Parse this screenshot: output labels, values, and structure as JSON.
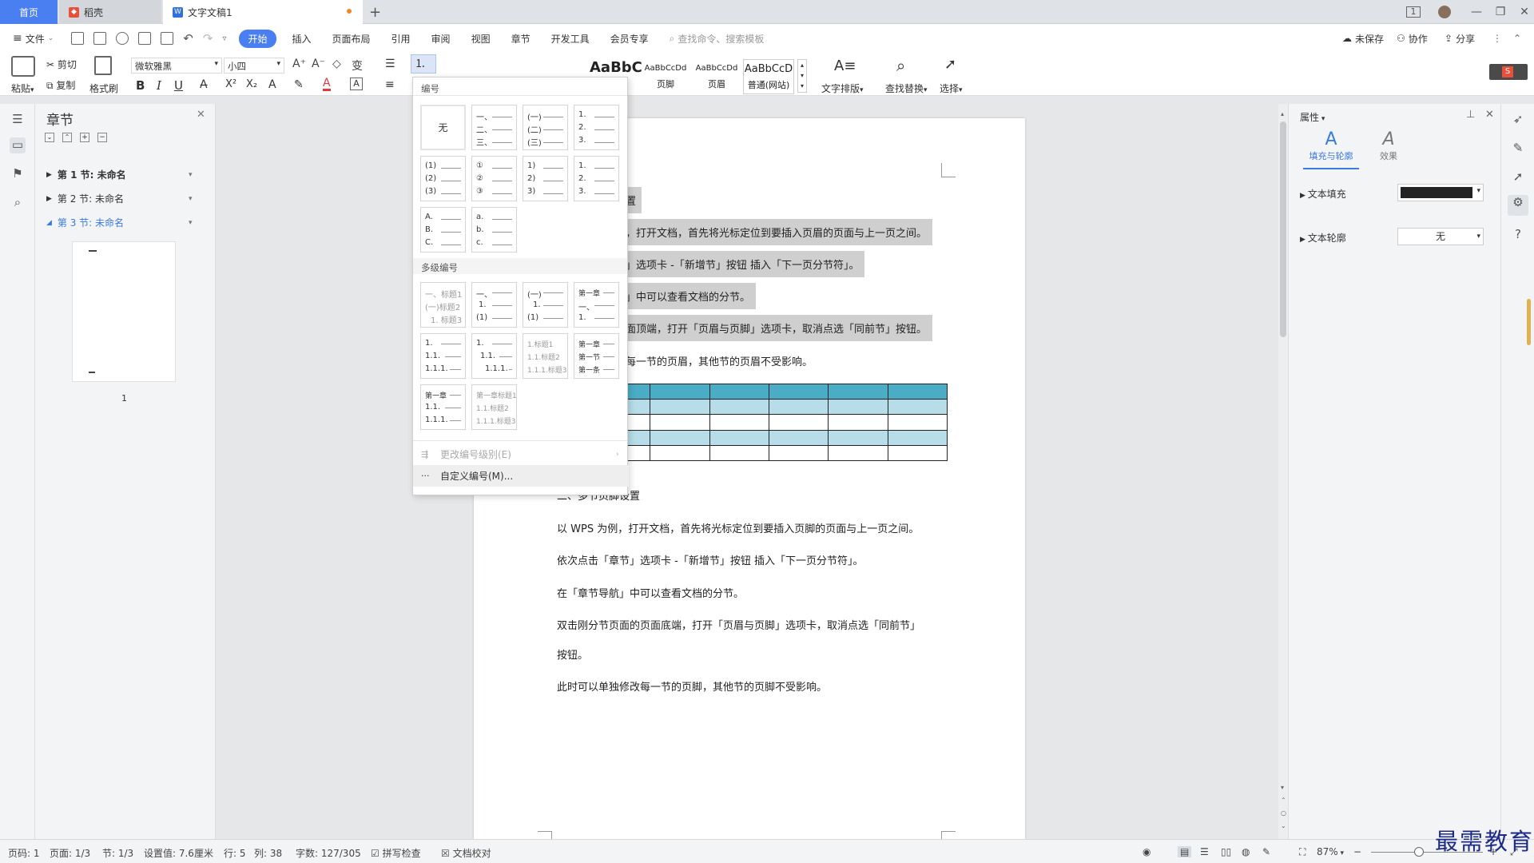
{
  "tabs": {
    "home": "首页",
    "daoke": "稻壳",
    "doc": "文字文稿1",
    "new": "+"
  },
  "menu": {
    "file": "文件",
    "items": [
      "开始",
      "插入",
      "页面布局",
      "引用",
      "审阅",
      "视图",
      "章节",
      "开发工具",
      "会员专享"
    ],
    "search_placeholder": "查找命令、搜索模板",
    "unsaved": "未保存",
    "collab": "协作",
    "share": "分享"
  },
  "ribbon": {
    "paste": "粘贴",
    "cut": "剪切",
    "copy": "复制",
    "format_painter": "格式刷",
    "font_name": "微软雅黑",
    "font_size": "小四",
    "bold": "B",
    "italic": "I",
    "underline": "U",
    "styles": [
      {
        "sample": "AaBbC",
        "name": ""
      },
      {
        "sample": "AaBbCcDd",
        "name": "页脚"
      },
      {
        "sample": "AaBbCcDd",
        "name": "页眉"
      },
      {
        "sample": "AaBbCcD",
        "name": "普通(网站)"
      }
    ],
    "text_layout": "文字排版",
    "find_replace": "查找替换",
    "select": "选择"
  },
  "section_panel": {
    "title": "章节",
    "items": [
      {
        "label": "第 1 节: 未命名",
        "active": false
      },
      {
        "label": "第 2 节: 未命名",
        "active": false
      },
      {
        "label": "第 3 节: 未命名",
        "active": true
      }
    ],
    "thumb_page": "1"
  },
  "numbering_dropdown": {
    "header": "编号",
    "none": "无",
    "single_presets": [
      [
        "一、",
        "二、",
        "三、"
      ],
      [
        "(一)",
        "(二)",
        "(三)"
      ],
      [
        "1.",
        "2.",
        "3."
      ],
      [
        "(1)",
        "(2)",
        "(3)"
      ],
      [
        "①",
        "②",
        "③"
      ],
      [
        "1)",
        "2)",
        "3)"
      ],
      [
        "1.",
        "2.",
        "3."
      ],
      [
        "A.",
        "B.",
        "C."
      ],
      [
        "a.",
        "b.",
        "c."
      ]
    ],
    "multi_header": "多级编号",
    "multi_presets": [
      [
        "一、标题1",
        "(一)标题2",
        "1. 标题3"
      ],
      [
        "一、",
        "1.",
        "(1)"
      ],
      [
        "(一)",
        "1.",
        "(1)"
      ],
      [
        "第一章",
        "一、",
        "1."
      ],
      [
        "1.",
        "1.1.",
        "1.1.1."
      ],
      [
        "1.",
        "1.1.",
        "1.1.1."
      ],
      [
        "1.标题1",
        "1.1.标题2",
        "1.1.1.标题3"
      ],
      [
        "第一章",
        "第一节",
        "第一条"
      ],
      [
        "第一章",
        "1.1.",
        "1.1.1."
      ],
      [
        "第一章标题1",
        "1.1.标题2",
        "1.1.1.标题3"
      ]
    ],
    "change_level": "更改编号级别(E)",
    "custom": "自定义编号(M)..."
  },
  "document": {
    "lines_top": [
      "设置",
      "例，打开文档，首先将光标定位到要插入页眉的页面与上一页之间。",
      "节」选项卡 -「新增节」按钮 插入「下一页分节符」。",
      "航」中可以查看文档的分节。",
      "页面顶端，打开「页眉与页脚」选项卡，取消点选「同前节」按钮。",
      "改每一节的页眉，其他节的页眉不受影响。"
    ],
    "heading2": "二、多节页脚设置",
    "lines_bottom": [
      "以 WPS 为例，打开文档，首先将光标定位到要插入页脚的页面与上一页之间。",
      "依次点击「章节」选项卡 -「新增节」按钮 插入「下一页分节符」。",
      " 在「章节导航」中可以查看文档的分节。",
      "双击刚分节页面的页面底端，打开「页眉与页脚」选项卡，取消点选「同前节」",
      "按钮。",
      "此时可以单独修改每一节的页脚，其他节的页脚不受影响。"
    ],
    "table_colors": {
      "header": "#4bacc6",
      "band": "#b7dde8",
      "plain": "#ffffff"
    }
  },
  "properties": {
    "title": "属性",
    "tab_fill": "填充与轮廓",
    "tab_effect": "效果",
    "text_fill": "文本填充",
    "text_outline": "文本轮廓",
    "outline_value": "无",
    "fill_color": "#222222"
  },
  "statusbar": {
    "page_num": "页码: 1",
    "pages": "页面: 1/3",
    "section": "节: 1/3",
    "setting": "设置值: 7.6厘米",
    "row": "行: 5",
    "col": "列: 38",
    "words": "字数: 127/305",
    "spell": "拼写检查",
    "proof": "文档校对",
    "zoom": "87%"
  },
  "watermark": "最需教育",
  "colors": {
    "accent": "#4a7ff1",
    "dropdown_hover": "#f0f0f0"
  }
}
